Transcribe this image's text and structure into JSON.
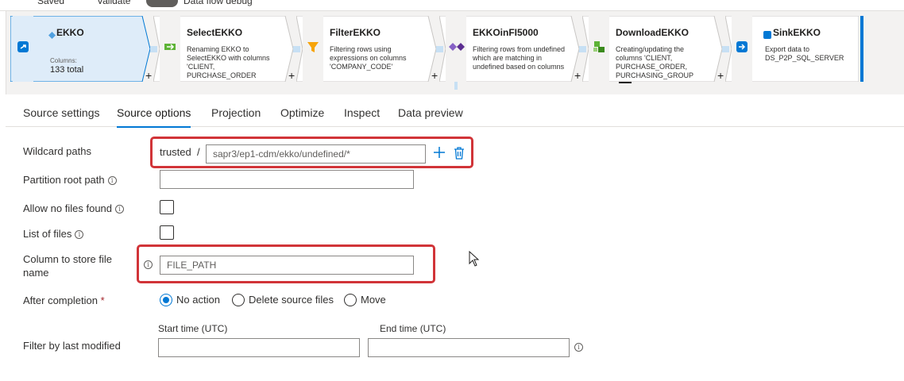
{
  "top": {
    "saved": "Saved",
    "validate": "Validate",
    "debug": "Data flow debug"
  },
  "pipeline": {
    "source": {
      "title": "EKKO",
      "columns_label": "Columns:",
      "total": "133 total"
    },
    "nodes": [
      {
        "title": "SelectEKKO",
        "desc": "Renaming EKKO to SelectEKKO with columns 'CLIENT, PURCHASE_ORDER",
        "icon": "select-icon"
      },
      {
        "title": "FilterEKKO",
        "desc": "Filtering rows using expressions on columns 'COMPANY_CODE'",
        "icon": "filter-icon"
      },
      {
        "title": "EKKOinFI5000",
        "desc": "Filtering rows from undefined which are matching in undefined based on columns",
        "icon": "exists-icon"
      },
      {
        "title": "DownloadEKKO",
        "desc": "Creating/updating the columns 'CLIENT, PURCHASE_ORDER, PURCHASING_GROUP",
        "icon": "derived-column-icon"
      },
      {
        "title": "SinkEKKO",
        "desc": "Export data to DS_P2P_SQL_SERVER",
        "icon": "sink-icon"
      }
    ],
    "plus": "+"
  },
  "tabs": [
    "Source settings",
    "Source options",
    "Projection",
    "Optimize",
    "Inspect",
    "Data preview"
  ],
  "active_tab": "Source options",
  "form": {
    "wildcard_label": "Wildcard paths",
    "wildcard_prefix": "trusted",
    "wildcard_sep": "/",
    "wildcard_value": "sapr3/ep1-cdm/ekko/undefined/*",
    "partition_label": "Partition root path",
    "allow_no_files_label": "Allow no files found",
    "list_of_files_label": "List of files",
    "column_store_label": "Column to store file name",
    "column_store_value": "FILE_PATH",
    "after_completion_label": "After completion",
    "required_mark": "*",
    "after_options": [
      "No action",
      "Delete source files",
      "Move"
    ],
    "after_selected": "No action",
    "filter_label": "Filter by last modified",
    "start_time_label": "Start time (UTC)",
    "end_time_label": "End time (UTC)",
    "info_glyph": "i"
  },
  "colors": {
    "accent": "#0078d4",
    "highlight": "#d13438"
  }
}
